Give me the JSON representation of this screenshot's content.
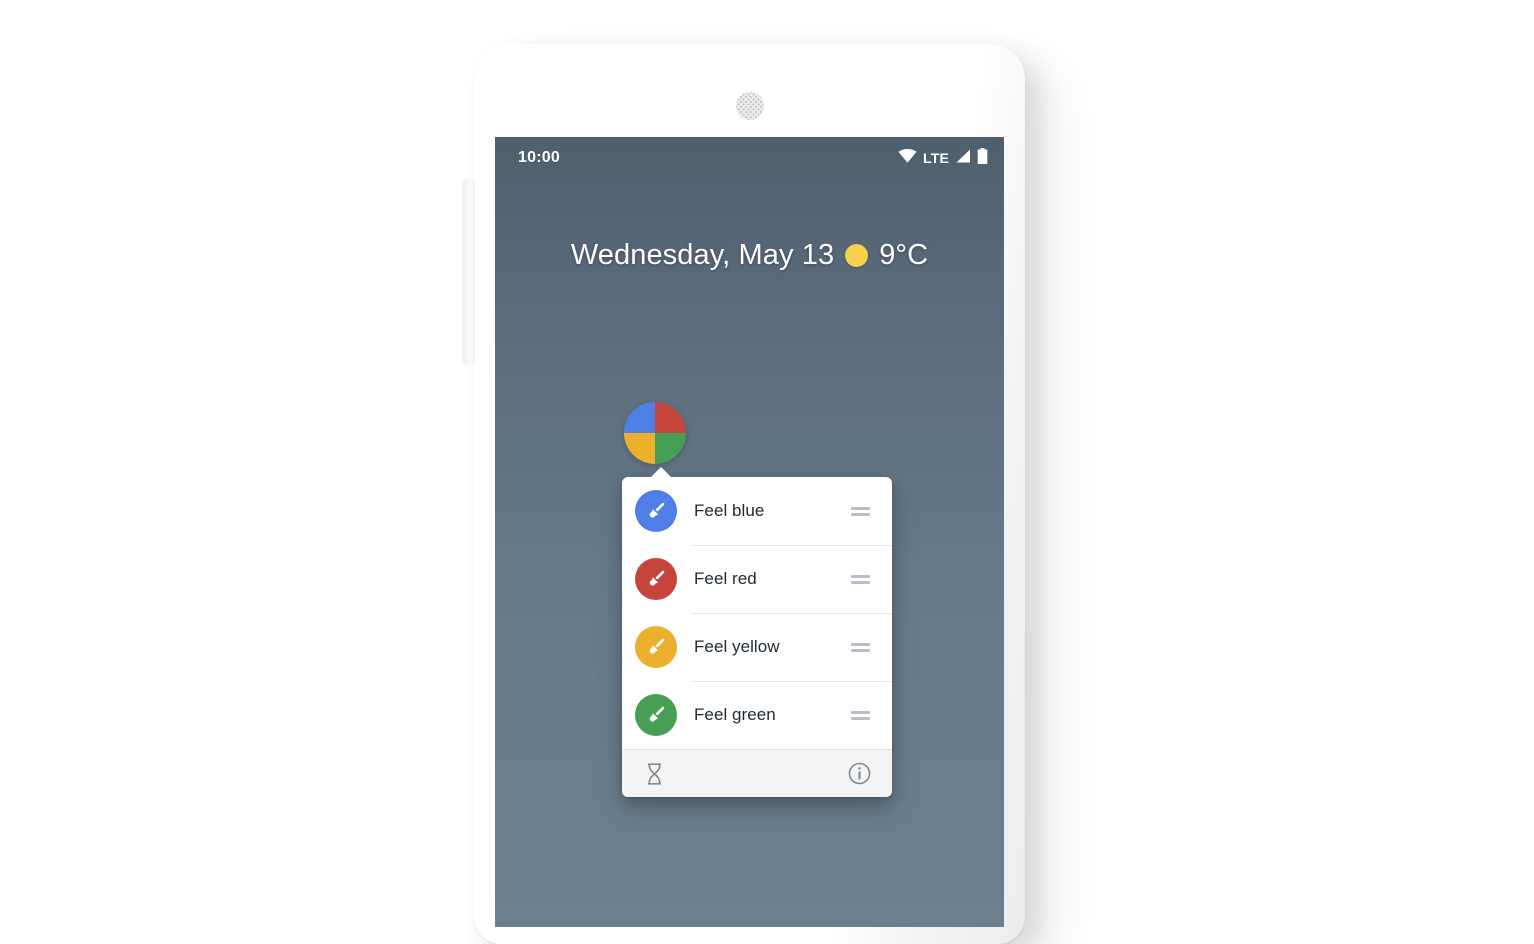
{
  "device": {
    "name": "android-phone-mockup",
    "speaker_grille": "speaker-grille",
    "side_button": "volume-button"
  },
  "status_bar": {
    "clock": "10:00",
    "network_label": "LTE",
    "icons": [
      "wifi-icon",
      "signal-icon",
      "battery-icon"
    ]
  },
  "home_screen": {
    "date": "Wednesday, May 13",
    "temperature": "9°C",
    "weather_icon": "sun-icon",
    "weather_icon_color": "#f4d04b",
    "wallpaper_top_color": "#4e5f6d",
    "wallpaper_bottom_color": "#6c7f8e"
  },
  "app_icon": {
    "name": "four-color-wheel-icon",
    "quadrants": [
      {
        "position": "top-left",
        "color": "#4f80e8"
      },
      {
        "position": "top-right",
        "color": "#c7443a"
      },
      {
        "position": "bottom-left",
        "color": "#edb02c"
      },
      {
        "position": "bottom-right",
        "color": "#45a055"
      }
    ]
  },
  "popup": {
    "shortcuts": [
      {
        "label": "Feel blue",
        "color": "#4f80e8",
        "icon": "paintbrush-icon",
        "handle": "drag-handle-icon"
      },
      {
        "label": "Feel red",
        "color": "#c7443a",
        "icon": "paintbrush-icon",
        "handle": "drag-handle-icon"
      },
      {
        "label": "Feel yellow",
        "color": "#edb02c",
        "icon": "paintbrush-icon",
        "handle": "drag-handle-icon"
      },
      {
        "label": "Feel green",
        "color": "#45a055",
        "icon": "paintbrush-icon",
        "handle": "drag-handle-icon"
      }
    ],
    "footer": {
      "left_icon": "hourglass-icon",
      "right_icon": "info-icon",
      "background_color": "#f4f4f4"
    }
  }
}
